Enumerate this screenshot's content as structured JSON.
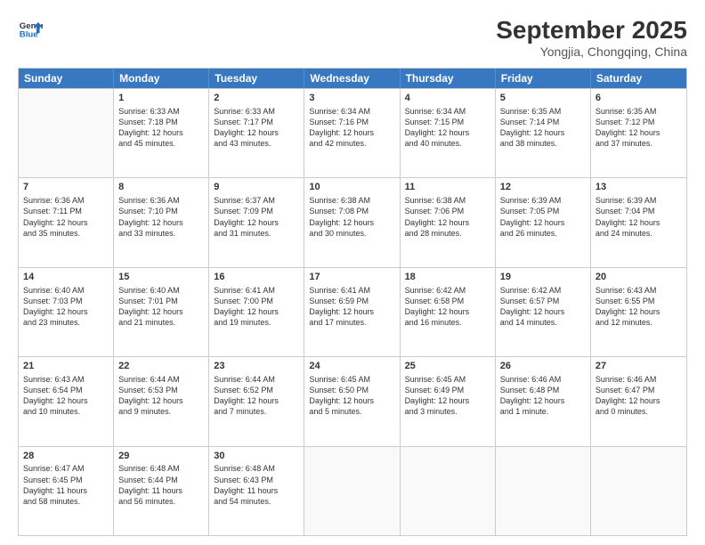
{
  "header": {
    "logo_line1": "General",
    "logo_line2": "Blue",
    "month": "September 2025",
    "location": "Yongjia, Chongqing, China"
  },
  "weekdays": [
    "Sunday",
    "Monday",
    "Tuesday",
    "Wednesday",
    "Thursday",
    "Friday",
    "Saturday"
  ],
  "rows": [
    [
      {
        "day": "",
        "info": ""
      },
      {
        "day": "1",
        "info": "Sunrise: 6:33 AM\nSunset: 7:18 PM\nDaylight: 12 hours\nand 45 minutes."
      },
      {
        "day": "2",
        "info": "Sunrise: 6:33 AM\nSunset: 7:17 PM\nDaylight: 12 hours\nand 43 minutes."
      },
      {
        "day": "3",
        "info": "Sunrise: 6:34 AM\nSunset: 7:16 PM\nDaylight: 12 hours\nand 42 minutes."
      },
      {
        "day": "4",
        "info": "Sunrise: 6:34 AM\nSunset: 7:15 PM\nDaylight: 12 hours\nand 40 minutes."
      },
      {
        "day": "5",
        "info": "Sunrise: 6:35 AM\nSunset: 7:14 PM\nDaylight: 12 hours\nand 38 minutes."
      },
      {
        "day": "6",
        "info": "Sunrise: 6:35 AM\nSunset: 7:12 PM\nDaylight: 12 hours\nand 37 minutes."
      }
    ],
    [
      {
        "day": "7",
        "info": "Sunrise: 6:36 AM\nSunset: 7:11 PM\nDaylight: 12 hours\nand 35 minutes."
      },
      {
        "day": "8",
        "info": "Sunrise: 6:36 AM\nSunset: 7:10 PM\nDaylight: 12 hours\nand 33 minutes."
      },
      {
        "day": "9",
        "info": "Sunrise: 6:37 AM\nSunset: 7:09 PM\nDaylight: 12 hours\nand 31 minutes."
      },
      {
        "day": "10",
        "info": "Sunrise: 6:38 AM\nSunset: 7:08 PM\nDaylight: 12 hours\nand 30 minutes."
      },
      {
        "day": "11",
        "info": "Sunrise: 6:38 AM\nSunset: 7:06 PM\nDaylight: 12 hours\nand 28 minutes."
      },
      {
        "day": "12",
        "info": "Sunrise: 6:39 AM\nSunset: 7:05 PM\nDaylight: 12 hours\nand 26 minutes."
      },
      {
        "day": "13",
        "info": "Sunrise: 6:39 AM\nSunset: 7:04 PM\nDaylight: 12 hours\nand 24 minutes."
      }
    ],
    [
      {
        "day": "14",
        "info": "Sunrise: 6:40 AM\nSunset: 7:03 PM\nDaylight: 12 hours\nand 23 minutes."
      },
      {
        "day": "15",
        "info": "Sunrise: 6:40 AM\nSunset: 7:01 PM\nDaylight: 12 hours\nand 21 minutes."
      },
      {
        "day": "16",
        "info": "Sunrise: 6:41 AM\nSunset: 7:00 PM\nDaylight: 12 hours\nand 19 minutes."
      },
      {
        "day": "17",
        "info": "Sunrise: 6:41 AM\nSunset: 6:59 PM\nDaylight: 12 hours\nand 17 minutes."
      },
      {
        "day": "18",
        "info": "Sunrise: 6:42 AM\nSunset: 6:58 PM\nDaylight: 12 hours\nand 16 minutes."
      },
      {
        "day": "19",
        "info": "Sunrise: 6:42 AM\nSunset: 6:57 PM\nDaylight: 12 hours\nand 14 minutes."
      },
      {
        "day": "20",
        "info": "Sunrise: 6:43 AM\nSunset: 6:55 PM\nDaylight: 12 hours\nand 12 minutes."
      }
    ],
    [
      {
        "day": "21",
        "info": "Sunrise: 6:43 AM\nSunset: 6:54 PM\nDaylight: 12 hours\nand 10 minutes."
      },
      {
        "day": "22",
        "info": "Sunrise: 6:44 AM\nSunset: 6:53 PM\nDaylight: 12 hours\nand 9 minutes."
      },
      {
        "day": "23",
        "info": "Sunrise: 6:44 AM\nSunset: 6:52 PM\nDaylight: 12 hours\nand 7 minutes."
      },
      {
        "day": "24",
        "info": "Sunrise: 6:45 AM\nSunset: 6:50 PM\nDaylight: 12 hours\nand 5 minutes."
      },
      {
        "day": "25",
        "info": "Sunrise: 6:45 AM\nSunset: 6:49 PM\nDaylight: 12 hours\nand 3 minutes."
      },
      {
        "day": "26",
        "info": "Sunrise: 6:46 AM\nSunset: 6:48 PM\nDaylight: 12 hours\nand 1 minute."
      },
      {
        "day": "27",
        "info": "Sunrise: 6:46 AM\nSunset: 6:47 PM\nDaylight: 12 hours\nand 0 minutes."
      }
    ],
    [
      {
        "day": "28",
        "info": "Sunrise: 6:47 AM\nSunset: 6:45 PM\nDaylight: 11 hours\nand 58 minutes."
      },
      {
        "day": "29",
        "info": "Sunrise: 6:48 AM\nSunset: 6:44 PM\nDaylight: 11 hours\nand 56 minutes."
      },
      {
        "day": "30",
        "info": "Sunrise: 6:48 AM\nSunset: 6:43 PM\nDaylight: 11 hours\nand 54 minutes."
      },
      {
        "day": "",
        "info": ""
      },
      {
        "day": "",
        "info": ""
      },
      {
        "day": "",
        "info": ""
      },
      {
        "day": "",
        "info": ""
      }
    ]
  ]
}
